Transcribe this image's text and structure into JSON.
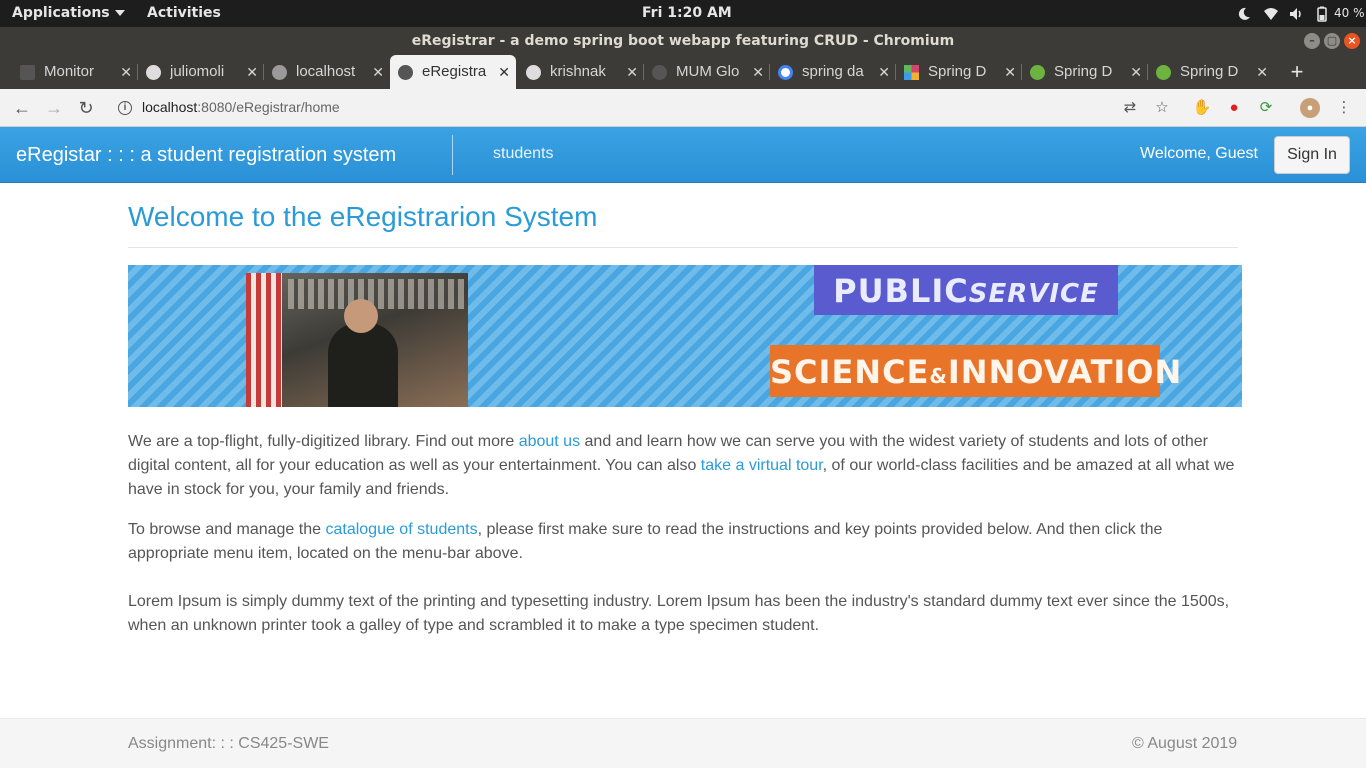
{
  "os": {
    "applications_label": "Applications",
    "activities_label": "Activities",
    "clock": "Fri  1:20 AM",
    "battery": "40 %"
  },
  "window": {
    "title": "eRegistrar - a demo spring boot webapp featuring CRUD - Chromium"
  },
  "tabs": [
    {
      "label": "Monitor ",
      "active": false,
      "icon_color": "#555555"
    },
    {
      "label": "juliomoli",
      "active": false,
      "icon_color": "#dddddd"
    },
    {
      "label": "localhost",
      "active": false,
      "icon_color": "#9a9a9a"
    },
    {
      "label": "eRegistra",
      "active": true,
      "icon_color": "#555555"
    },
    {
      "label": "krishnak",
      "active": false,
      "icon_color": "#dddddd"
    },
    {
      "label": "MUM Glo",
      "active": false,
      "icon_color": "#555555"
    },
    {
      "label": "spring da",
      "active": false,
      "icon_color": "#4285f4"
    },
    {
      "label": "Spring D",
      "active": false,
      "icon_color": "#d4456b"
    },
    {
      "label": "Spring D",
      "active": false,
      "icon_color": "#6db33f"
    },
    {
      "label": "Spring D",
      "active": false,
      "icon_color": "#6db33f"
    }
  ],
  "browser": {
    "url_host": "localhost",
    "url_rest": ":8080/eRegistrar/home"
  },
  "site": {
    "brand": "eRegistar : : : a student registration system",
    "nav_students": "students",
    "welcome": "Welcome, Guest",
    "signin": "Sign In"
  },
  "page": {
    "title": "Welcome to the eRegistrarion System",
    "banner": {
      "public": "PUBLIC",
      "service": "SERVICE",
      "science": "SCIENCE",
      "amp": "&",
      "innovation": "INNOVATION"
    },
    "p1": {
      "t1": "We are a top-flight, fully-digitized library. Find out more ",
      "link1": "about us",
      "t2": " and and learn how we can serve you with the widest variety of students and lots of other digital content, all for your education as well as your entertainment. You can also ",
      "link2": "take a virtual tour",
      "t3": ", of our world-class facilities and be amazed at all what we have in stock for you, your family and friends."
    },
    "p2": {
      "t1": "To browse and manage the ",
      "link": "catalogue of students",
      "t2": ", please first make sure to read the instructions and key points provided below. And then click the appropriate menu item, located on the menu-bar above."
    },
    "p3": "Lorem Ipsum is simply dummy text of the printing and typesetting industry. Lorem Ipsum has been the industry's standard dummy text ever since the 1500s, when an unknown printer took a galley of type and scrambled it to make a type specimen student."
  },
  "footer": {
    "left": "Assignment: : : CS425-SWE",
    "right": "© August 2019"
  }
}
